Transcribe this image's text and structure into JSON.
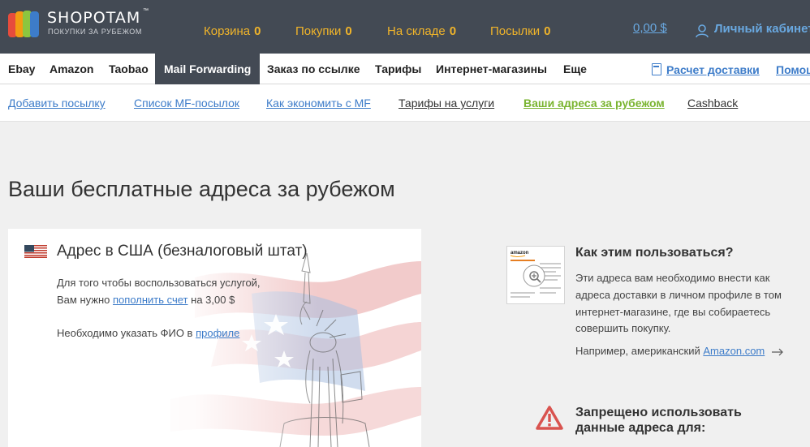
{
  "header": {
    "logo_text": "SHOPOTAM",
    "logo_tm": "™",
    "logo_sub": "ПОКУПКИ ЗА РУБЕЖОМ",
    "stats": [
      {
        "label": "Корзина",
        "count": "0"
      },
      {
        "label": "Покупки",
        "count": "0"
      },
      {
        "label": "На складе",
        "count": "0"
      },
      {
        "label": "Посылки",
        "count": "0"
      }
    ],
    "balance": "0,00 $",
    "cabinet": "Личный кабинет"
  },
  "nav": {
    "items": [
      "Ebay",
      "Amazon",
      "Taobao",
      "Mail Forwarding",
      "Заказ по ссылке",
      "Тарифы",
      "Интернет-магазины",
      "Еще"
    ],
    "delivery_calc": "Расчет доставки",
    "help": "Помощь"
  },
  "subnav": {
    "items": [
      "Добавить посылку",
      "Список MF-посылок",
      "Как экономить с MF",
      "Тарифы на услуги",
      "Ваши адреса за рубежом",
      "Cashback"
    ]
  },
  "page": {
    "title": "Ваши бесплатные адреса за рубежом"
  },
  "card": {
    "title": "Адрес в США (безналоговый штат)",
    "line1": "Для того чтобы воспользоваться услугой,",
    "line2_prefix": "Вам нужно",
    "line2_link": "пополнить счет",
    "line2_suffix": "на 3,00 $",
    "line3_prefix": "Необходимо указать ФИО в",
    "line3_link": "профиле"
  },
  "how": {
    "title": "Как этим пользоваться?",
    "lines": [
      "Эти адреса вам необходимо внести как",
      "адреса доставки в личном профиле в том",
      "интернет-магазине, где вы собираетесь",
      "совершить покупку."
    ],
    "example_prefix": "Например, американский",
    "example_link": "Amazon.com",
    "thumb_brand": "amazon"
  },
  "warning": {
    "title_line1": "Запрещено использовать",
    "title_line2": "данные адреса для:"
  },
  "colors": {
    "header_bg": "#434a54",
    "accent_orange": "#f0b42a",
    "link_blue": "#3d7cc9",
    "active_green": "#7ab430",
    "warning_red": "#d9534f"
  }
}
